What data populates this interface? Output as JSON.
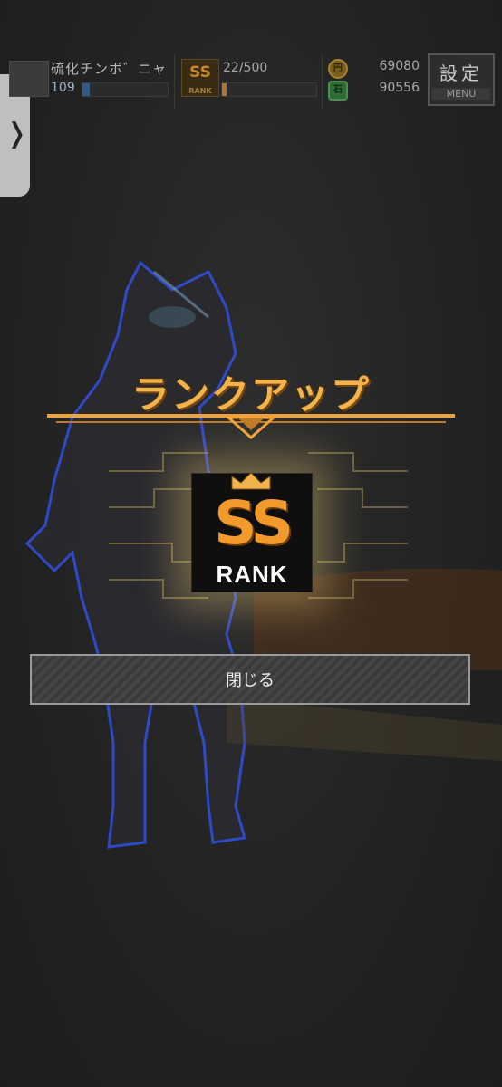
{
  "status_bar": {
    "player_name": "硫化チンボ゛ニャ",
    "player_level": "109",
    "level_progress": 0.08,
    "rank_icon_text": "SS",
    "rank_icon_sub": "RANK",
    "rank_progress_text": "22/500",
    "rank_progress": 0.044,
    "coin_icon": "coin-icon",
    "coin_value": "69080",
    "gem_icon": "gem-icon",
    "gem_value": "90556",
    "menu_kanji": "設定",
    "menu_label": "MENU"
  },
  "side_tab": {
    "arrow": "❭"
  },
  "rankup": {
    "title": "ランクアップ",
    "badge_letters": "SS",
    "badge_rank": "RANK",
    "close_label": "閉じる"
  },
  "colors": {
    "accent_gold": "#f2b44a",
    "badge_orange": "#f29a2c",
    "background": "#232323"
  }
}
